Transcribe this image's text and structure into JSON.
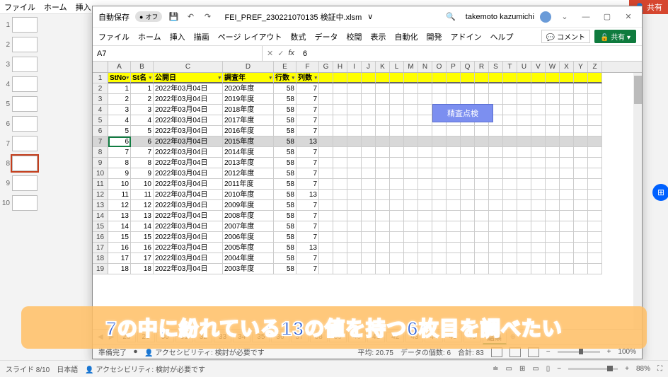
{
  "ppt": {
    "menu": [
      "ファイル",
      "ホーム",
      "挿入"
    ],
    "share_label": "共有",
    "slide_counter": "スライド 8/10",
    "lang": "日本語",
    "access": "アクセシビリティ: 検討が必要です",
    "zoom": "88%",
    "thumbs": [
      1,
      2,
      3,
      4,
      5,
      6,
      7,
      8,
      9,
      10
    ],
    "selected_thumb": 8
  },
  "excel": {
    "autosave_label": "自動保存",
    "autosave_state": "オフ",
    "filename": "FEI_PREF_230221070135 検証中.xlsm",
    "username": "takemoto kazumichi",
    "ribbon": [
      "ファイル",
      "ホーム",
      "挿入",
      "描画",
      "ページ レイアウト",
      "数式",
      "データ",
      "校閲",
      "表示",
      "自動化",
      "開発",
      "アドイン",
      "ヘルプ"
    ],
    "comment_btn": "コメント",
    "share_btn": "共有",
    "namebox": "A7",
    "formula_value": "6",
    "col_letters": [
      "A",
      "B",
      "C",
      "D",
      "E",
      "F",
      "G",
      "H",
      "I",
      "J",
      "K",
      "L",
      "M",
      "N",
      "O",
      "P",
      "Q",
      "R",
      "S",
      "T",
      "U",
      "V",
      "W",
      "X",
      "Y",
      "Z"
    ],
    "headers": [
      "StNo",
      "St名",
      "公開日",
      "調査年",
      "行数",
      "列数"
    ],
    "selected_row_index": 6,
    "rows": [
      {
        "n": 1,
        "a": 1,
        "b": 1,
        "c": "2022年03月04日",
        "d": "2020年度",
        "e": 58,
        "f": 7
      },
      {
        "n": 2,
        "a": 2,
        "b": 2,
        "c": "2022年03月04日",
        "d": "2019年度",
        "e": 58,
        "f": 7
      },
      {
        "n": 3,
        "a": 3,
        "b": 3,
        "c": "2022年03月04日",
        "d": "2018年度",
        "e": 58,
        "f": 7
      },
      {
        "n": 4,
        "a": 4,
        "b": 4,
        "c": "2022年03月04日",
        "d": "2017年度",
        "e": 58,
        "f": 7
      },
      {
        "n": 5,
        "a": 5,
        "b": 5,
        "c": "2022年03月04日",
        "d": "2016年度",
        "e": 58,
        "f": 7
      },
      {
        "n": 6,
        "a": 6,
        "b": 6,
        "c": "2022年03月04日",
        "d": "2015年度",
        "e": 58,
        "f": 13
      },
      {
        "n": 7,
        "a": 7,
        "b": 7,
        "c": "2022年03月04日",
        "d": "2014年度",
        "e": 58,
        "f": 7
      },
      {
        "n": 8,
        "a": 8,
        "b": 8,
        "c": "2022年03月04日",
        "d": "2013年度",
        "e": 58,
        "f": 7
      },
      {
        "n": 9,
        "a": 9,
        "b": 9,
        "c": "2022年03月04日",
        "d": "2012年度",
        "e": 58,
        "f": 7
      },
      {
        "n": 10,
        "a": 10,
        "b": 10,
        "c": "2022年03月04日",
        "d": "2011年度",
        "e": 58,
        "f": 7
      },
      {
        "n": 11,
        "a": 11,
        "b": 11,
        "c": "2022年03月04日",
        "d": "2010年度",
        "e": 58,
        "f": 13
      },
      {
        "n": 12,
        "a": 12,
        "b": 12,
        "c": "2022年03月04日",
        "d": "2009年度",
        "e": 58,
        "f": 7
      },
      {
        "n": 13,
        "a": 13,
        "b": 13,
        "c": "2022年03月04日",
        "d": "2008年度",
        "e": 58,
        "f": 7
      },
      {
        "n": 14,
        "a": 14,
        "b": 14,
        "c": "2022年03月04日",
        "d": "2007年度",
        "e": 58,
        "f": 7
      },
      {
        "n": 15,
        "a": 15,
        "b": 15,
        "c": "2022年03月04日",
        "d": "2006年度",
        "e": 58,
        "f": 7
      },
      {
        "n": 16,
        "a": 16,
        "b": 16,
        "c": "2022年03月04日",
        "d": "2005年度",
        "e": 58,
        "f": 13
      },
      {
        "n": 17,
        "a": 17,
        "b": 17,
        "c": "2022年03月04日",
        "d": "2004年度",
        "e": 58,
        "f": 7
      },
      {
        "n": 18,
        "a": 18,
        "b": 18,
        "c": "2022年03月04日",
        "d": "2003年度",
        "e": 58,
        "f": 7
      }
    ],
    "chart_button": "精査点検",
    "sheet_tabs": [
      "28",
      "29",
      "30",
      "31",
      "32",
      "33",
      "34",
      "35",
      "36",
      "37",
      "38",
      "39",
      "40",
      "41",
      "42",
      "43",
      "44",
      "45",
      "46",
      "結果"
    ],
    "active_tab": "結果",
    "status": {
      "ready": "準備完了",
      "access": "アクセシビリティ: 検討が必要です",
      "avg_label": "平均:",
      "avg": "20.75",
      "count_label": "データの個数:",
      "count": "6",
      "sum_label": "合計:",
      "sum": "83",
      "zoom": "100%"
    }
  },
  "caption": "7の中に紛れている13の値を持つ6枚目を調べたい"
}
